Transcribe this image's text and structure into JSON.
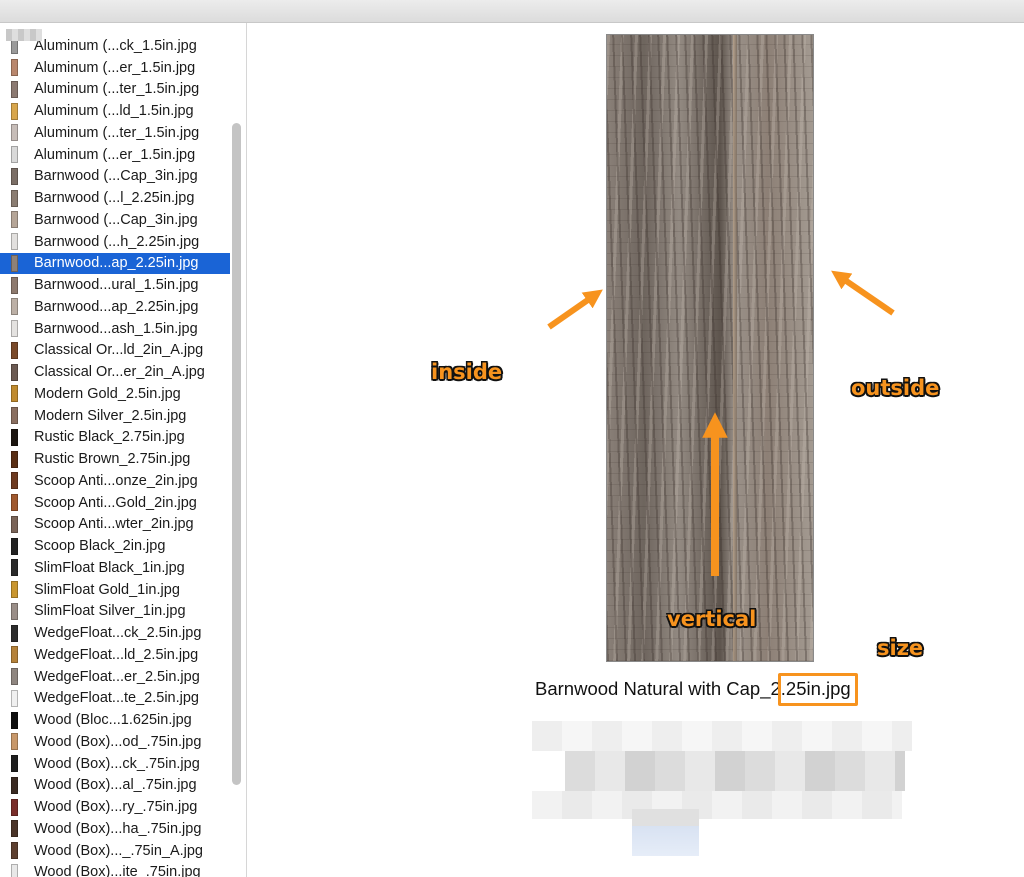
{
  "sidebar": {
    "items": [
      {
        "label": "Aluminum (...ck_1.5in.jpg",
        "thumb": "#9a9a9a"
      },
      {
        "label": "Aluminum (...er_1.5in.jpg",
        "thumb": "#b9876d"
      },
      {
        "label": "Aluminum (...ter_1.5in.jpg",
        "thumb": "#8c7a72"
      },
      {
        "label": "Aluminum (...ld_1.5in.jpg",
        "thumb": "#d8a64c"
      },
      {
        "label": "Aluminum (...ter_1.5in.jpg",
        "thumb": "#c7bdb8"
      },
      {
        "label": "Aluminum (...er_1.5in.jpg",
        "thumb": "#d9d9d9"
      },
      {
        "label": "Barnwood (...Cap_3in.jpg",
        "thumb": "#7b6e66"
      },
      {
        "label": "Barnwood (...l_2.25in.jpg",
        "thumb": "#8b7d72"
      },
      {
        "label": "Barnwood (...Cap_3in.jpg",
        "thumb": "#b5a597"
      },
      {
        "label": "Barnwood (...h_2.25in.jpg",
        "thumb": "#e2e0de"
      },
      {
        "label": "Barnwood...ap_2.25in.jpg",
        "thumb": "#8e8178",
        "selected": true
      },
      {
        "label": "Barnwood...ural_1.5in.jpg",
        "thumb": "#8e7a6e"
      },
      {
        "label": "Barnwood...ap_2.25in.jpg",
        "thumb": "#bcb0a6"
      },
      {
        "label": "Barnwood...ash_1.5in.jpg",
        "thumb": "#e4e2e0"
      },
      {
        "label": "Classical Or...ld_2in_A.jpg",
        "thumb": "#7a4a2a"
      },
      {
        "label": "Classical Or...er_2in_A.jpg",
        "thumb": "#6b5a52"
      },
      {
        "label": "Modern Gold_2.5in.jpg",
        "thumb": "#c08b2f"
      },
      {
        "label": "Modern Silver_2.5in.jpg",
        "thumb": "#8a6f60"
      },
      {
        "label": "Rustic Black_2.75in.jpg",
        "thumb": "#1c1510"
      },
      {
        "label": "Rustic Brown_2.75in.jpg",
        "thumb": "#5a2e14"
      },
      {
        "label": "Scoop Anti...onze_2in.jpg",
        "thumb": "#6e3a20"
      },
      {
        "label": "Scoop Anti...Gold_2in.jpg",
        "thumb": "#a0592e"
      },
      {
        "label": "Scoop Anti...wter_2in.jpg",
        "thumb": "#7a6458"
      },
      {
        "label": "Scoop Black_2in.jpg",
        "thumb": "#222222"
      },
      {
        "label": "SlimFloat Black_1in.jpg",
        "thumb": "#2a2a2a"
      },
      {
        "label": "SlimFloat Gold_1in.jpg",
        "thumb": "#c9962f"
      },
      {
        "label": "SlimFloat Silver_1in.jpg",
        "thumb": "#9a8e88"
      },
      {
        "label": "WedgeFloat...ck_2.5in.jpg",
        "thumb": "#2c2c2c"
      },
      {
        "label": "WedgeFloat...ld_2.5in.jpg",
        "thumb": "#b5823a"
      },
      {
        "label": "WedgeFloat...er_2.5in.jpg",
        "thumb": "#8f8680"
      },
      {
        "label": "WedgeFloat...te_2.5in.jpg",
        "thumb": "#f0f0f0"
      },
      {
        "label": "Wood (Bloc...1.625in.jpg",
        "thumb": "#0e0e0e"
      },
      {
        "label": "Wood (Box)...od_.75in.jpg",
        "thumb": "#c8986a"
      },
      {
        "label": "Wood (Box)...ck_.75in.jpg",
        "thumb": "#1e1e1e"
      },
      {
        "label": "Wood (Box)...al_.75in.jpg",
        "thumb": "#3a2a22"
      },
      {
        "label": "Wood (Box)...ry_.75in.jpg",
        "thumb": "#7a2e2a"
      },
      {
        "label": "Wood (Box)...ha_.75in.jpg",
        "thumb": "#4a3428"
      },
      {
        "label": "Wood (Box)..._.75in_A.jpg",
        "thumb": "#5e4030"
      },
      {
        "label": "Wood (Box)...ite_.75in.jpg",
        "thumb": "#e8e8e8"
      }
    ]
  },
  "preview": {
    "caption": "Barnwood Natural with Cap_2.25in.jpg"
  },
  "annotations": {
    "inside": "inside",
    "outside": "outside",
    "vertical": "vertical",
    "size": "size"
  },
  "colors": {
    "accent": "#f7931e",
    "selection": "#1a64d6"
  }
}
